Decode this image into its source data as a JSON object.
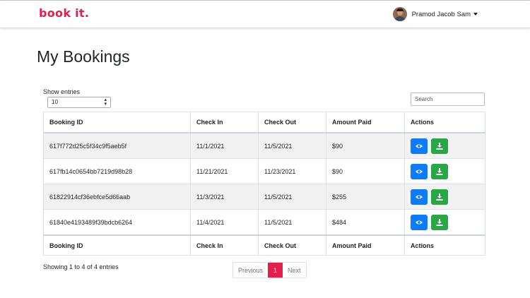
{
  "brand": {
    "name": "book it.",
    "color": "#e61e4d"
  },
  "user": {
    "name": "Pramod Jacob Sam",
    "avatar_icon": "user-avatar"
  },
  "page": {
    "title": "My Bookings"
  },
  "table_controls": {
    "length_label": "Show entries",
    "length_value": "10",
    "search_placeholder": "Search"
  },
  "table": {
    "headers": [
      "Booking ID",
      "Check In",
      "Check Out",
      "Amount Paid",
      "Actions"
    ],
    "rows": [
      {
        "booking_id": "617f772d25c5f34c9f5aeb5f",
        "check_in": "11/1/2021",
        "check_out": "11/5/2021",
        "amount_paid": "$90"
      },
      {
        "booking_id": "617fb14c0654bb7219d98b28",
        "check_in": "11/21/2021",
        "check_out": "11/23/2021",
        "amount_paid": "$90"
      },
      {
        "booking_id": "61822914cf36ebfce5d66aab",
        "check_in": "11/3/2021",
        "check_out": "11/5/2021",
        "amount_paid": "$255"
      },
      {
        "booking_id": "61840e4193489f39bdcb6264",
        "check_in": "11/4/2021",
        "check_out": "11/5/2021",
        "amount_paid": "$484"
      }
    ],
    "action_icons": [
      "eye-icon",
      "download-icon"
    ],
    "action_colors": {
      "view": "#0d7bff",
      "download": "#27a745"
    }
  },
  "footer": {
    "info": "Showing 1 to 4 of 4 entries",
    "pagination": {
      "previous": "Previous",
      "current": "1",
      "next": "Next",
      "active_color": "#e61e4d"
    }
  }
}
